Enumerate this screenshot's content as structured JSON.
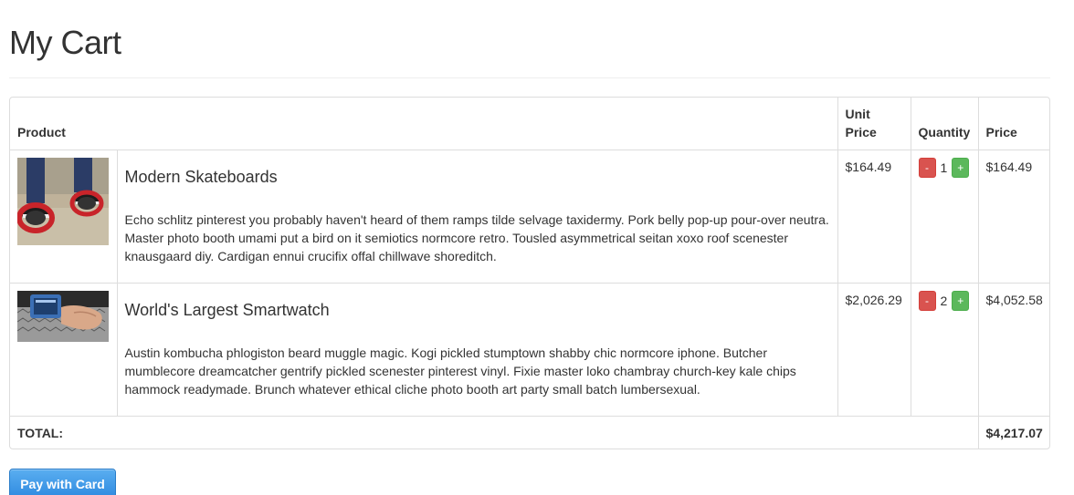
{
  "page": {
    "title": "My Cart"
  },
  "table": {
    "headers": {
      "product": "Product",
      "unit_price": "Unit Price",
      "quantity": "Quantity",
      "price": "Price"
    },
    "items": [
      {
        "image_icon": "skateboard-photo",
        "name": "Modern Skateboards",
        "description": "Echo schlitz pinterest you probably haven't heard of them ramps tilde selvage taxidermy. Pork belly pop-up pour-over neutra. Master photo booth umami put a bird on it semiotics normcore retro. Tousled asymmetrical seitan xoxo roof scenester knausgaard diy. Cardigan ennui crucifix offal chillwave shoreditch.",
        "unit_price": "$164.49",
        "quantity": "1",
        "price": "$164.49",
        "minus_label": "-",
        "plus_label": "+"
      },
      {
        "image_icon": "smartwatch-photo",
        "name": "World's Largest Smartwatch",
        "description": "Austin kombucha phlogiston beard muggle magic. Kogi pickled stumptown shabby chic normcore iphone. Butcher mumblecore dreamcatcher gentrify pickled scenester pinterest vinyl. Fixie master loko chambray church-key kale chips hammock readymade. Brunch whatever ethical cliche photo booth art party small batch lumbersexual.",
        "unit_price": "$2,026.29",
        "quantity": "2",
        "price": "$4,052.58",
        "minus_label": "-",
        "plus_label": "+"
      }
    ],
    "total": {
      "label": "TOTAL:",
      "value": "$4,217.07"
    }
  },
  "actions": {
    "pay_label": "Pay with Card"
  },
  "colors": {
    "minus_button": "#d9534f",
    "plus_button": "#5cb85c",
    "pay_button": "#3a94e4",
    "border": "#dddddd"
  }
}
